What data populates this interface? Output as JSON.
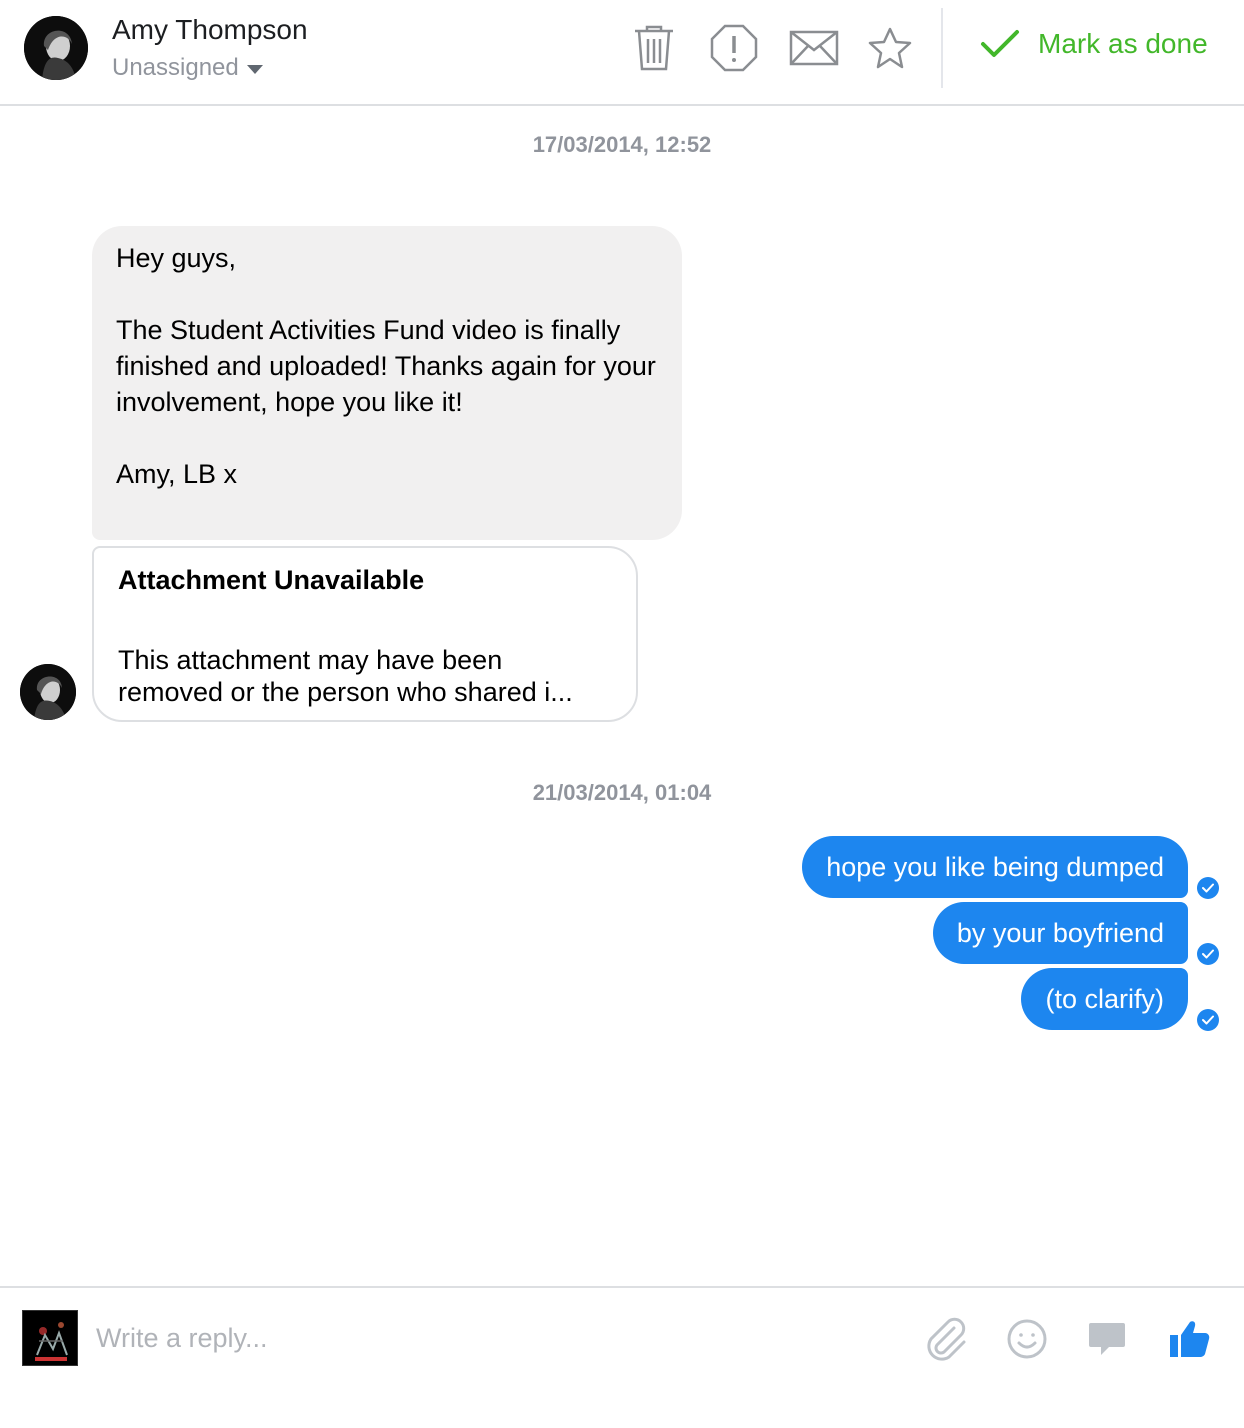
{
  "header": {
    "contact_name": "Amy Thompson",
    "assignee": "Unassigned",
    "tools": [
      "trash-icon",
      "report-icon",
      "mail-icon",
      "star-icon"
    ],
    "mark_done_label": "Mark as done",
    "accent_green": "#42b72a"
  },
  "thread": {
    "timestamp_1": "17/03/2014, 12:52",
    "incoming_message": "Hey guys,\n\nThe Student Activities Fund video is finally finished and uploaded! Thanks again for your involvement, hope you like it!\n\nAmy, LB x",
    "attachment": {
      "title": "Attachment Unavailable",
      "body": "This attachment may have been removed or the person who shared i..."
    },
    "timestamp_2": "21/03/2014, 01:04",
    "outgoing_messages": [
      "hope you like being dumped",
      "by your boyfriend",
      "(to clarify)"
    ],
    "outgoing_color": "#1d86ef"
  },
  "composer": {
    "placeholder": "Write a reply...",
    "icons": [
      "paperclip-icon",
      "emoji-icon",
      "sticker-icon",
      "thumbs-up-icon"
    ]
  }
}
